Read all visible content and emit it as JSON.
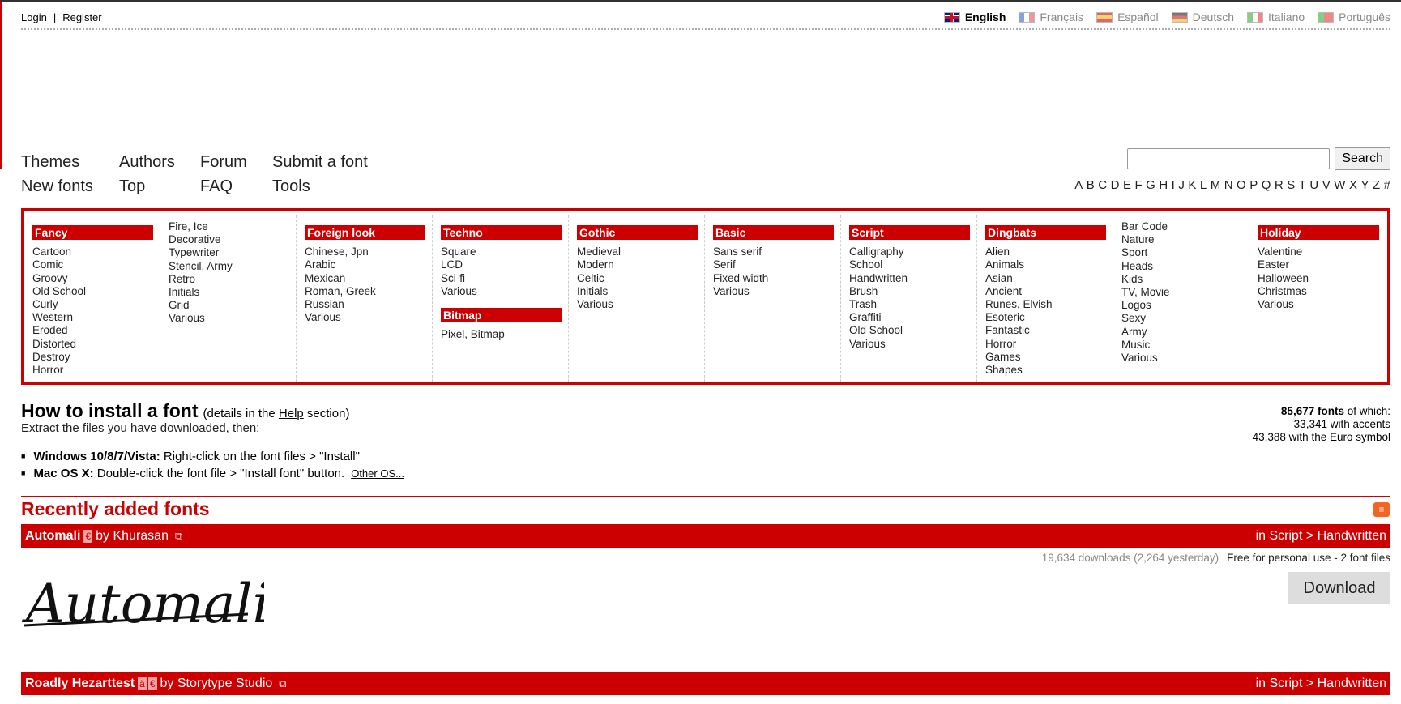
{
  "account": {
    "login": "Login",
    "register": "Register",
    "sep": "|"
  },
  "languages": [
    {
      "label": "English",
      "active": true
    },
    {
      "label": "Français",
      "active": false
    },
    {
      "label": "Español",
      "active": false
    },
    {
      "label": "Deutsch",
      "active": false
    },
    {
      "label": "Italiano",
      "active": false
    },
    {
      "label": "Português",
      "active": false
    }
  ],
  "nav": {
    "themes": "Themes",
    "new_fonts": "New fonts",
    "authors": "Authors",
    "top": "Top",
    "forum": "Forum",
    "faq": "FAQ",
    "submit": "Submit a font",
    "tools": "Tools"
  },
  "search": {
    "button": "Search",
    "value": ""
  },
  "alphabet": [
    "A",
    "B",
    "C",
    "D",
    "E",
    "F",
    "G",
    "H",
    "I",
    "J",
    "K",
    "L",
    "M",
    "N",
    "O",
    "P",
    "Q",
    "R",
    "S",
    "T",
    "U",
    "V",
    "W",
    "X",
    "Y",
    "Z",
    "#"
  ],
  "categories": [
    {
      "head": "Fancy",
      "items": [
        "Cartoon",
        "Comic",
        "Groovy",
        "Old School",
        "Curly",
        "Western",
        "Eroded",
        "Distorted",
        "Destroy",
        "Horror"
      ]
    },
    {
      "head": "",
      "items": [
        "Fire, Ice",
        "Decorative",
        "Typewriter",
        "Stencil, Army",
        "Retro",
        "Initials",
        "Grid",
        "Various"
      ]
    },
    {
      "head": "Foreign look",
      "items": [
        "Chinese, Jpn",
        "Arabic",
        "Mexican",
        "Roman, Greek",
        "Russian",
        "Various"
      ]
    },
    {
      "head": "Techno",
      "items": [
        "Square",
        "LCD",
        "Sci-fi",
        "Various"
      ],
      "head2": "Bitmap",
      "items2": [
        "Pixel, Bitmap"
      ]
    },
    {
      "head": "Gothic",
      "items": [
        "Medieval",
        "Modern",
        "Celtic",
        "Initials",
        "Various"
      ]
    },
    {
      "head": "Basic",
      "items": [
        "Sans serif",
        "Serif",
        "Fixed width",
        "Various"
      ]
    },
    {
      "head": "Script",
      "items": [
        "Calligraphy",
        "School",
        "Handwritten",
        "Brush",
        "Trash",
        "Graffiti",
        "Old School",
        "Various"
      ]
    },
    {
      "head": "Dingbats",
      "items": [
        "Alien",
        "Animals",
        "Asian",
        "Ancient",
        "Runes, Elvish",
        "Esoteric",
        "Fantastic",
        "Horror",
        "Games",
        "Shapes"
      ]
    },
    {
      "head": "",
      "items": [
        "Bar Code",
        "Nature",
        "Sport",
        "Heads",
        "Kids",
        "TV, Movie",
        "Logos",
        "Sexy",
        "Army",
        "Music",
        "Various"
      ]
    },
    {
      "head": "Holiday",
      "items": [
        "Valentine",
        "Easter",
        "Halloween",
        "Christmas",
        "Various"
      ]
    }
  ],
  "install": {
    "title": "How to install a font",
    "details_pre": "(details in the",
    "details_link": "Help",
    "details_post": "section)",
    "text": "Extract the files you have downloaded, then:",
    "win_label": "Windows 10/8/7/Vista:",
    "win_text": " Right-click on the font files > \"Install\"",
    "mac_label": "Mac OS X:",
    "mac_text": " Double-click the font file > \"Install font\" button.",
    "other": "Other OS..."
  },
  "stats": {
    "count": "85,677 fonts",
    "count_suffix": " of which:",
    "accents": "33,341 with accents",
    "euro": "43,388 with the Euro symbol"
  },
  "recent": {
    "title": "Recently added fonts",
    "fonts": [
      {
        "name": "Automali",
        "badges": [
          "€"
        ],
        "by": "by Khurasan",
        "category": "in Script > Handwritten",
        "downloads": "19,634 downloads (2,264 yesterday)",
        "license": "Free for personal use - 2 font files",
        "download": "Download",
        "preview": "Automali"
      },
      {
        "name": "Roadly Hezarttest",
        "badges": [
          "à",
          "€"
        ],
        "by": "by Storytype Studio",
        "category": "in Script > Handwritten"
      }
    ]
  },
  "colors": {
    "brand": "#cc0000",
    "rss": "#f26522"
  }
}
